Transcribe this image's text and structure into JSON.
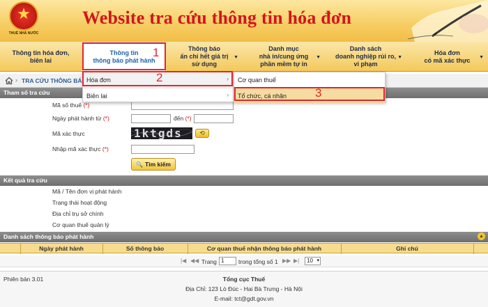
{
  "app": {
    "title": "Website tra cứu thông tin hóa đơn",
    "emblem_text": "THUẾ NHÀ NƯỚC"
  },
  "menu": {
    "items": [
      {
        "label": "Thông tin hóa đơn,\nbiên lai",
        "has_arrow": false
      },
      {
        "label": "Thông tin\nthông báo phát hành",
        "has_arrow": false,
        "active": true
      },
      {
        "label": "Thông báo\nấn chỉ hết giá trị\nsử dụng",
        "has_arrow": true
      },
      {
        "label": "Danh mục\nnhà in/cung ứng\nphần mềm tự in",
        "has_arrow": true
      },
      {
        "label": "Danh sách\ndoanh nghiệp rủi ro,\nvi phạm",
        "has_arrow": true
      },
      {
        "label": "Hóa đơn\ncó mã xác thực",
        "has_arrow": true
      }
    ]
  },
  "breadcrumb": {
    "sep": "›",
    "current": "TRA CỨU THÔNG BÁO"
  },
  "dropdown": {
    "level1": [
      {
        "label": "Hóa đơn"
      },
      {
        "label": "Biên lai"
      }
    ],
    "level2": [
      {
        "label": "Cơ quan thuế"
      },
      {
        "label": "Tổ chức, cá nhân"
      }
    ]
  },
  "annotations": [
    "1",
    "2",
    "3"
  ],
  "search": {
    "section_title": "Tham số tra cứu",
    "tax_code_label": "Mã số thuế",
    "issue_date_from_label": "Ngày phát hành từ",
    "to_label": "đến",
    "required_mark": "(*)",
    "captcha_label": "Mã xác thực",
    "captcha_text": "1ktgds",
    "captcha_input_label": "Nhập mã xác thực",
    "search_button": "Tìm kiếm",
    "refresh_glyph": "⟲",
    "search_glyph": "🔍"
  },
  "results": {
    "section_title": "Kết quả tra cứu",
    "fields": [
      "Mã / Tên đơn vị phát hành",
      "Trạng thái hoạt động",
      "Địa chỉ trụ sở chính",
      "Cơ quan thuế quản lý"
    ]
  },
  "table": {
    "section_title": "Danh sách thông báo phát hành",
    "collapse_glyph": "▲",
    "columns": [
      "Ngày phát hành",
      "Số thông báo",
      "Cơ quan thuế nhận thông báo phát hành",
      "Ghi chú"
    ],
    "pager": {
      "first": "|◀",
      "prev": "◀◀",
      "next": "▶▶",
      "last": "▶|",
      "page_label": "Trang",
      "page_value": "1",
      "total_label": "trong tổng số 1",
      "page_size": "10"
    }
  },
  "footer": {
    "version": "Phiên bản 3.01",
    "org": "Tổng cục Thuế",
    "address": "Địa Chỉ: 123 Lò Đúc - Hai Bà Trưng - Hà Nội",
    "email": "E-mail: tct@gdt.gov.vn"
  }
}
